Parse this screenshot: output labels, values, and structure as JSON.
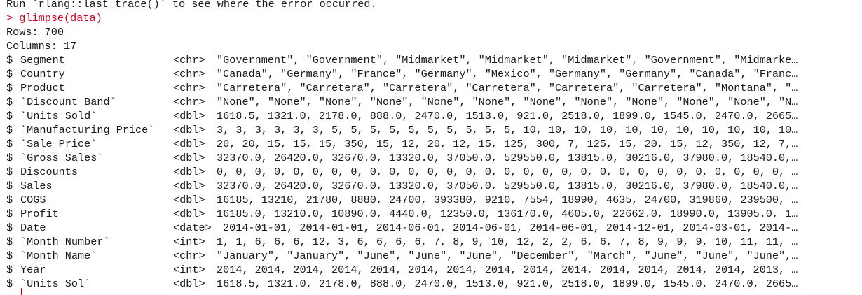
{
  "console": {
    "prev_message": "Run `rlang::last_trace()` to see where the error occurred.",
    "prompt_symbol": ">",
    "command": "glimpse(data)",
    "rows_line": "Rows: 700",
    "columns_line": "Columns: 17",
    "field_prefix": "$",
    "fields": [
      {
        "name": "Segment",
        "type": "<chr>",
        "values": "\"Government\", \"Government\", \"Midmarket\", \"Midmarket\", \"Midmarket\", \"Government\", \"Midmarke…"
      },
      {
        "name": "Country",
        "type": "<chr>",
        "values": "\"Canada\", \"Germany\", \"France\", \"Germany\", \"Mexico\", \"Germany\", \"Germany\", \"Canada\", \"Franc…"
      },
      {
        "name": "Product",
        "type": "<chr>",
        "values": "\"Carretera\", \"Carretera\", \"Carretera\", \"Carretera\", \"Carretera\", \"Carretera\", \"Montana\", \"…"
      },
      {
        "name": "`Discount Band`",
        "type": "<chr>",
        "values": "\"None\", \"None\", \"None\", \"None\", \"None\", \"None\", \"None\", \"None\", \"None\", \"None\", \"None\", \"N…"
      },
      {
        "name": "`Units Sold`",
        "type": "<dbl>",
        "values": "1618.5, 1321.0, 2178.0, 888.0, 2470.0, 1513.0, 921.0, 2518.0, 1899.0, 1545.0, 2470.0, 2665…"
      },
      {
        "name": "`Manufacturing Price`",
        "type": "<dbl>",
        "values": "3, 3, 3, 3, 3, 3, 5, 5, 5, 5, 5, 5, 5, 5, 5, 5, 10, 10, 10, 10, 10, 10, 10, 10, 10, 10, 10…"
      },
      {
        "name": "`Sale Price`",
        "type": "<dbl>",
        "values": "20, 20, 15, 15, 15, 350, 15, 12, 20, 12, 15, 125, 300, 7, 125, 15, 20, 15, 12, 350, 12, 7,…"
      },
      {
        "name": "`Gross Sales`",
        "type": "<dbl>",
        "values": "32370.0, 26420.0, 32670.0, 13320.0, 37050.0, 529550.0, 13815.0, 30216.0, 37980.0, 18540.0,…"
      },
      {
        "name": "Discounts",
        "type": "<dbl>",
        "values": "0, 0, 0, 0, 0, 0, 0, 0, 0, 0, 0, 0, 0, 0, 0, 0, 0, 0, 0, 0, 0, 0, 0, 0, 0, 0, 0, 0, 0, 0, …"
      },
      {
        "name": "Sales",
        "type": "<dbl>",
        "values": "32370.0, 26420.0, 32670.0, 13320.0, 37050.0, 529550.0, 13815.0, 30216.0, 37980.0, 18540.0,…"
      },
      {
        "name": "COGS",
        "type": "<dbl>",
        "values": "16185, 13210, 21780, 8880, 24700, 393380, 9210, 7554, 18990, 4635, 24700, 319860, 239500, …"
      },
      {
        "name": "Profit",
        "type": "<dbl>",
        "values": "16185.0, 13210.0, 10890.0, 4440.0, 12350.0, 136170.0, 4605.0, 22662.0, 18990.0, 13905.0, 1…"
      },
      {
        "name": "Date",
        "type": "<date>",
        "values": "2014-01-01, 2014-01-01, 2014-06-01, 2014-06-01, 2014-06-01, 2014-12-01, 2014-03-01, 2014-…"
      },
      {
        "name": "`Month Number`",
        "type": "<int>",
        "values": "1, 1, 6, 6, 6, 12, 3, 6, 6, 6, 6, 7, 8, 9, 10, 12, 2, 2, 6, 6, 7, 8, 9, 9, 9, 10, 11, 11, …"
      },
      {
        "name": "`Month Name`",
        "type": "<chr>",
        "values": "\"January\", \"January\", \"June\", \"June\", \"June\", \"December\", \"March\", \"June\", \"June\", \"June\",…"
      },
      {
        "name": "Year",
        "type": "<int>",
        "values": "2014, 2014, 2014, 2014, 2014, 2014, 2014, 2014, 2014, 2014, 2014, 2014, 2014, 2014, 2013, …"
      },
      {
        "name": "`Units Sol`",
        "type": "<dbl>",
        "values": "1618.5, 1321.0, 2178.0, 888.0, 2470.0, 1513.0, 921.0, 2518.0, 1899.0, 1545.0, 2470.0, 2665…"
      }
    ]
  },
  "colors": {
    "background": "#ffffff",
    "text": "#1a1a1a",
    "command": "#d0021b"
  }
}
